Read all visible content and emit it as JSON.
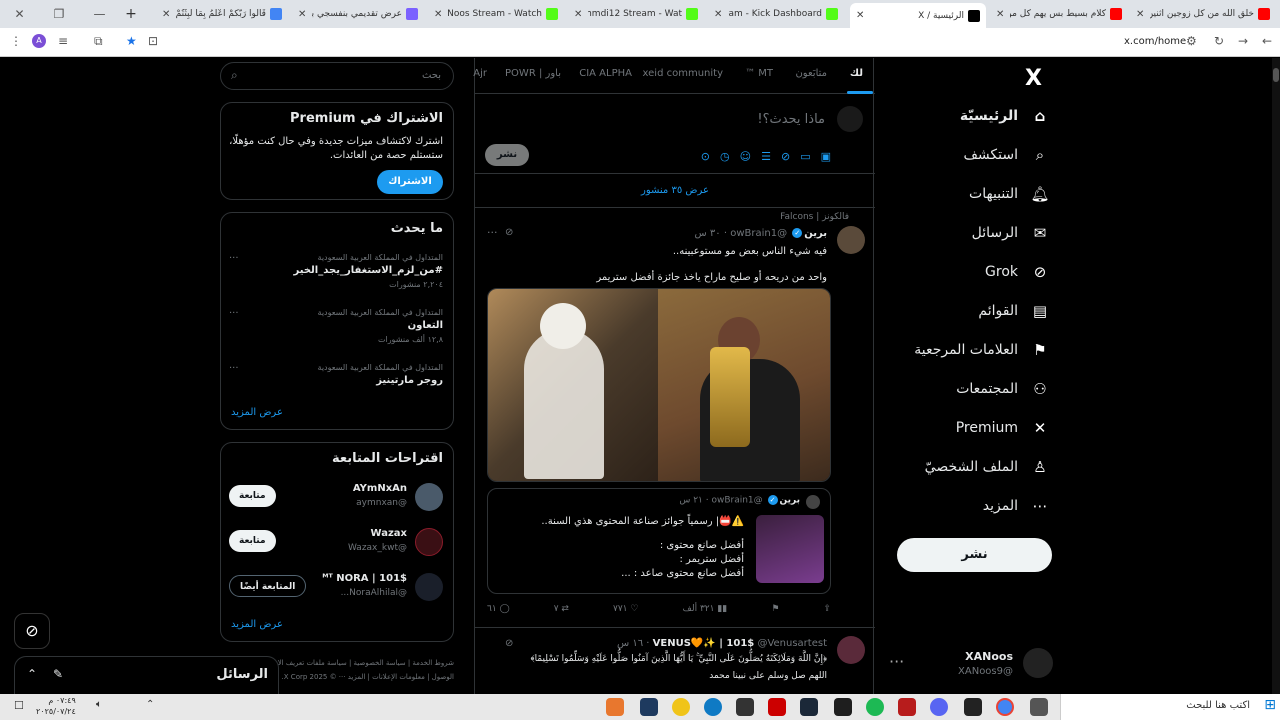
{
  "browser": {
    "tabs": [
      {
        "title": "خلق الله من كل زوجين اثنين",
        "color": "#ff0000"
      },
      {
        "title": "كلام بسيط بس يهم كل مو",
        "color": "#ff0000"
      },
      {
        "title": "الرئيسية / X",
        "color": "#000000",
        "active": true
      },
      {
        "title": "Stream - Kick Dashboard",
        "color": "#53fc18"
      },
      {
        "title": "Mohmdi12 Stream - Wat",
        "color": "#53fc18"
      },
      {
        "title": "XANoos Stream - Watch",
        "color": "#53fc18"
      },
      {
        "title": "عرض تقديمي بنفسجي بتد",
        "color": "#7b61ff"
      },
      {
        "title": "قَالُوا رَبُّكُمْ أَعْلَمُ بِمَا لَبِثْتُمْ",
        "color": "#4285f4"
      }
    ],
    "url": "x.com/home"
  },
  "nav": {
    "logo": "X",
    "items": [
      {
        "label": "الرئيسيّة",
        "icon": "home-icon",
        "glyph": "⌂"
      },
      {
        "label": "استكشف",
        "icon": "search-icon",
        "glyph": "⌕"
      },
      {
        "label": "التنبيهات",
        "icon": "bell-icon",
        "glyph": "🔔︎"
      },
      {
        "label": "الرسائل",
        "icon": "mail-icon",
        "glyph": "✉"
      },
      {
        "label": "Grok",
        "icon": "grok-icon",
        "glyph": "⊘"
      },
      {
        "label": "القوائم",
        "icon": "list-icon",
        "glyph": "▤"
      },
      {
        "label": "العلامات المرجعية",
        "icon": "bookmark-icon",
        "glyph": "⚑"
      },
      {
        "label": "المجتمعات",
        "icon": "communities-icon",
        "glyph": "⚇"
      },
      {
        "label": "Premium",
        "icon": "x-premium-icon",
        "glyph": "✕"
      },
      {
        "label": "الملف الشخصيّ",
        "icon": "profile-icon",
        "glyph": "♙"
      },
      {
        "label": "المزيد",
        "icon": "more-icon",
        "glyph": "⋯"
      }
    ],
    "post_label": "نشر",
    "account": {
      "name": "XANoos",
      "handle": "@XANoos9"
    }
  },
  "timeline": {
    "tabs": [
      "لك",
      "متابَعون",
      "MT ™",
      "xeid community",
      "CIA ALPHA",
      "باور | POWR",
      "Ajr"
    ],
    "compose_placeholder": "ماذا يحدث؟!",
    "compose_post": "نشر",
    "show_posts": "عرض ٣٥ منشور",
    "tweet1": {
      "context": "فالكونز | Falcons",
      "name": "برين",
      "handle": "@owBrain1",
      "time": "· ٣٠ س",
      "line1": "فيه شيء الناس بعض مو مستوعبينه..",
      "line2": "واحد من دريحه أو صليح ماراح ياخذ جائزة أفضل ستريمر",
      "quote": {
        "name": "برين",
        "handle": "@owBrain1",
        "time": "· ٢١ س",
        "lines": [
          "⚠️📛| رسمياً جوائز صناعة المحتوى هذي السنة..",
          "",
          "أفضل صانع محتوى :",
          "أفضل ستريمر :",
          "أفضل صانع محتوى صاعد : ..."
        ]
      },
      "actions": {
        "replies": "٦١",
        "retweets": "٧",
        "likes": "٧٧١",
        "views": "٣٢١ ألف"
      }
    },
    "tweet2": {
      "name": "VENUS🧡✨ | 101$",
      "handle": "@Venusartest",
      "time": "· ١٦ س",
      "line1": "﴿إِنَّ اللَّهَ وَمَلَائِكَتَهُ يُصَلُّونَ عَلَى النَّبِيِّ ۚ يَا أَيُّهَا الَّذِينَ آمَنُوا صَلُّوا عَلَيْهِ وَسَلِّمُوا تَسْلِيمًا﴾",
      "line2": "اللهم صل وسلم على نبينا محمد"
    }
  },
  "sidebar": {
    "search_placeholder": "بحث",
    "premium": {
      "title": "الاشتراك في Premium",
      "desc": "اشترك لاكتشاف ميزات جديدة وفي حال كنت مؤهلًا، ستستلم حصة من العائدات.",
      "button": "الاشتراك"
    },
    "trends_title": "ما يحدث",
    "trends": [
      {
        "category": "المتداول في المملكة العربية السعودية",
        "title": "#من_لزم_الاستغفار_يجد_الخير",
        "count": "٢,٢٠٤ منشورات"
      },
      {
        "category": "المتداول في المملكة العربية السعودية",
        "title": "التعاون",
        "count": "١٢,٨ ألف منشورات"
      },
      {
        "category": "المتداول في المملكة العربية السعودية",
        "title": "روجر مارتينيز",
        "count": ""
      }
    ],
    "show_more": "عرض المزيد",
    "who_title": "اقتراحات المتابعة",
    "who": [
      {
        "name": "AYmNxAn",
        "handle": "@aymnxan",
        "button": "متابعة"
      },
      {
        "name": "Wazax",
        "handle": "@Wazax_kwt",
        "button": "متابعة"
      },
      {
        "name": "ᴹᵀ NORA | 101$",
        "handle": "@NoraAlhilal...",
        "button": "المتابعة أيضًا"
      }
    ],
    "who_more": "عرض المزيد",
    "footer": "شروط الخدمة | سياسة الخصوصية | سياسة ملفات تعريف الارتباط | إمكانية الوصول | معلومات الإعلانات | المزيد ··· © 2025 X Corp."
  },
  "messages_drawer": {
    "title": "الرسائل"
  },
  "taskbar": {
    "search_placeholder": "اكتب هنا للبحث",
    "time": "٠٧:٤٩ م",
    "date": "٢٠٢٥/٠٧/٢٤"
  }
}
